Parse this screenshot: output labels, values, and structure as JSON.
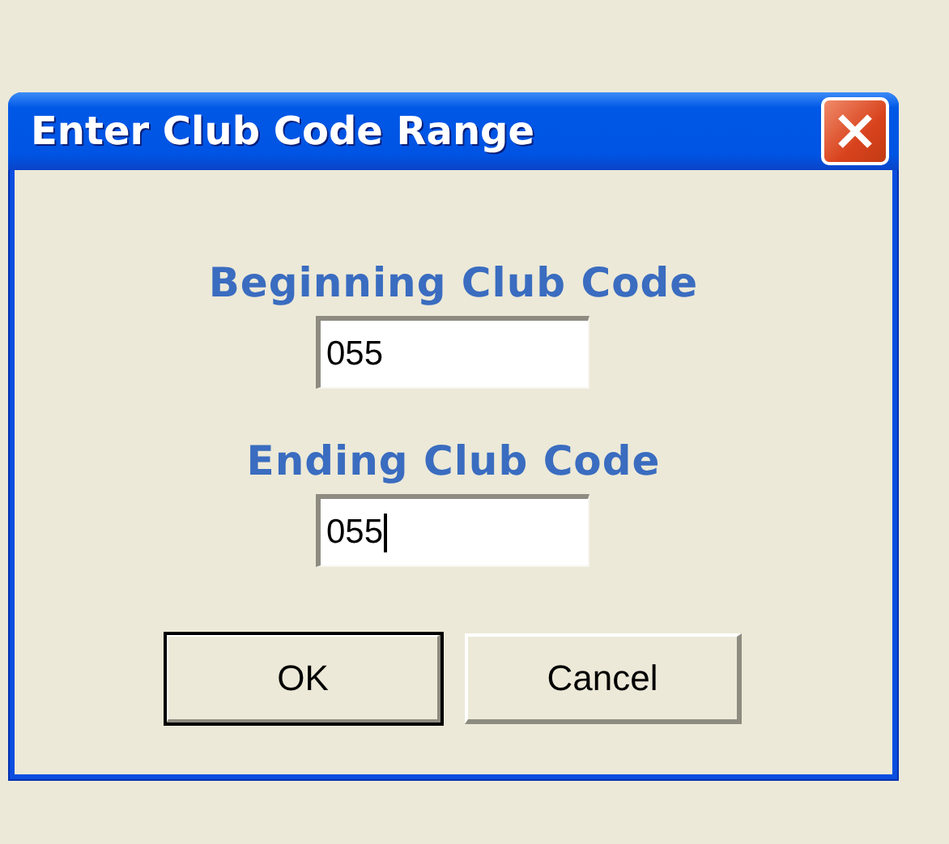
{
  "window": {
    "title": "Enter Club Code Range"
  },
  "fields": [
    {
      "label": "Beginning Club Code",
      "value": "055",
      "focused": false
    },
    {
      "label": "Ending Club Code",
      "value": "055",
      "focused": true
    }
  ],
  "buttons": [
    {
      "label": "OK",
      "default": true
    },
    {
      "label": "Cancel",
      "default": false
    }
  ]
}
